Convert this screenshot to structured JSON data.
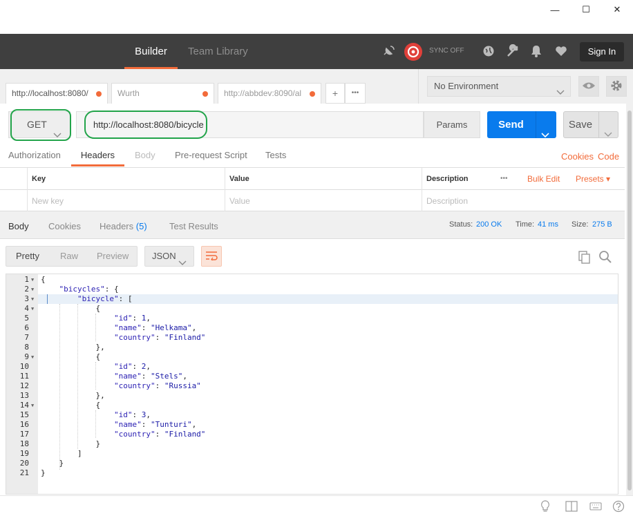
{
  "window": {
    "minimize_glyph": "—",
    "maximize_glyph": "☐",
    "close_glyph": "✕"
  },
  "header": {
    "tabs": [
      {
        "label": "Builder",
        "active": true
      },
      {
        "label": "Team Library",
        "active": false
      }
    ],
    "sync_label": "SYNC OFF",
    "signin_label": "Sign In",
    "icons": [
      "satellite-icon",
      "sync-icon",
      "globe-icon",
      "wrench-icon",
      "bell-icon",
      "heart-icon"
    ]
  },
  "request_tabs": [
    {
      "label": "http://localhost:8080/",
      "modified": true,
      "active": true
    },
    {
      "label": "Wurth",
      "modified": true,
      "active": false
    },
    {
      "label": "http://abbdev:8090/al",
      "modified": true,
      "active": false
    }
  ],
  "tab_controls": {
    "add": "+",
    "more": "•••"
  },
  "environment": {
    "selected": "No Environment"
  },
  "request": {
    "method": "GET",
    "url": "http://localhost:8080/bicycle",
    "params_label": "Params",
    "send_label": "Send",
    "save_label": "Save"
  },
  "request_subtabs": [
    "Authorization",
    "Headers",
    "Body",
    "Pre-request Script",
    "Tests"
  ],
  "request_links": {
    "cookies": "Cookies",
    "code": "Code"
  },
  "headers_table": {
    "columns": [
      "Key",
      "Value",
      "Description"
    ],
    "more": "•••",
    "bulk_edit": "Bulk Edit",
    "presets": "Presets ▾",
    "placeholders": {
      "key": "New key",
      "value": "Value",
      "description": "Description"
    }
  },
  "response": {
    "tabs": [
      "Body",
      "Cookies",
      "Headers",
      "Test Results"
    ],
    "headers_count": "(5)",
    "status_label": "Status:",
    "status_value": "200 OK",
    "time_label": "Time:",
    "time_value": "41 ms",
    "size_label": "Size:",
    "size_value": "275 B"
  },
  "view": {
    "options": [
      "Pretty",
      "Raw",
      "Preview"
    ],
    "format": "JSON"
  },
  "code_lines": [
    "{",
    "    \"bicycles\": {",
    "        \"bicycle\": [",
    "            {",
    "                \"id\": 1,",
    "                \"name\": \"Helkama\",",
    "                \"country\": \"Finland\"",
    "            },",
    "            {",
    "                \"id\": 2,",
    "                \"name\": \"Stels\",",
    "                \"country\": \"Russia\"",
    "            },",
    "            {",
    "                \"id\": 3,",
    "                \"name\": \"Tunturi\",",
    "                \"country\": \"Finland\"",
    "            }",
    "        ]",
    "    }",
    "}"
  ],
  "fold_lines": [
    1,
    2,
    3,
    4,
    9,
    14
  ],
  "accent_color": "#f26b3a",
  "send_color": "#097bed"
}
